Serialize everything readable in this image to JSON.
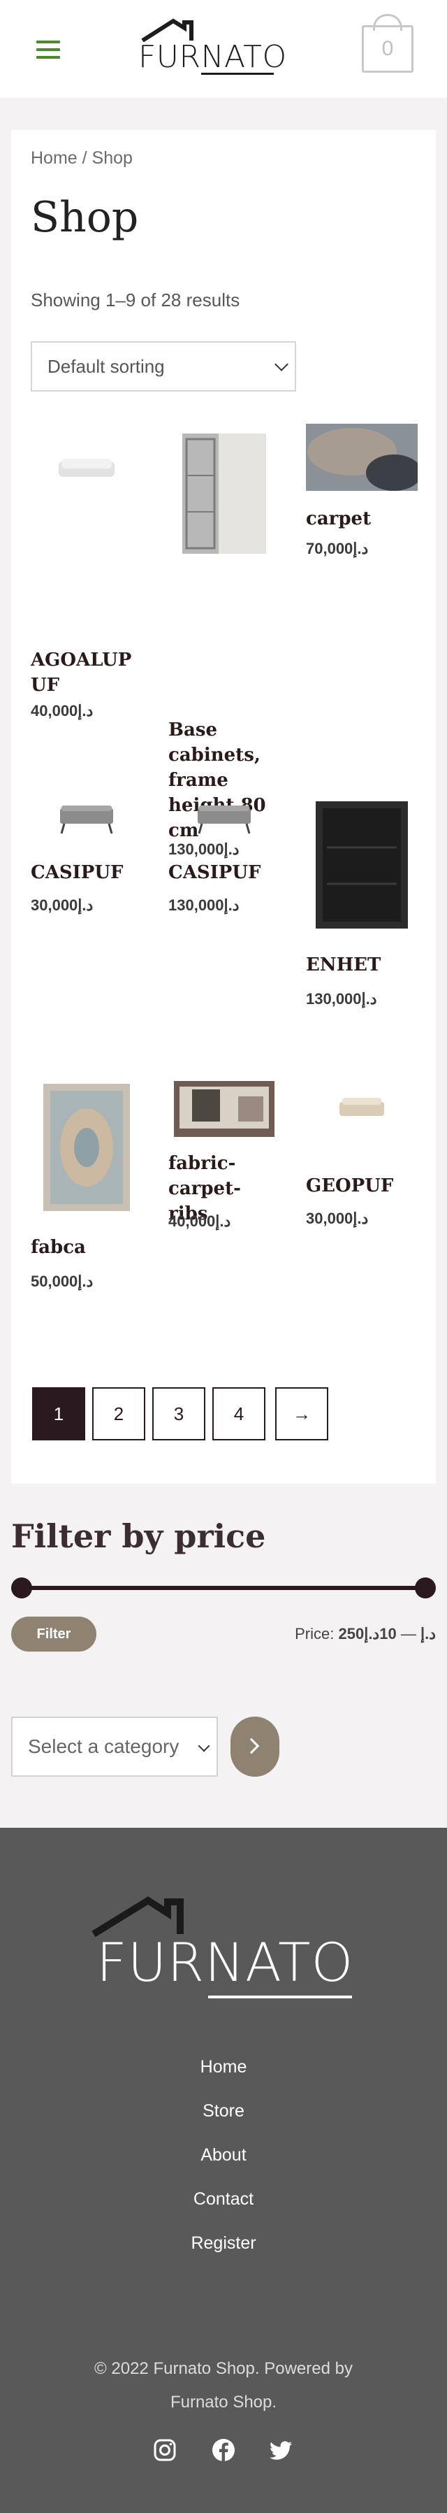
{
  "header": {
    "logo_text": "FURNATO",
    "cart_count": "0"
  },
  "breadcrumb": "Home / Shop",
  "page_title": "Shop",
  "result_count": "Showing 1–9 of 28 results",
  "sorting": {
    "selected": "Default sorting"
  },
  "products": [
    {
      "name": "AGOALUP UF",
      "price": "40,000د.إ"
    },
    {
      "name": "Base cabinets, frame height 80 cm",
      "price": "130,000د.إ"
    },
    {
      "name": "carpet",
      "price": "70,000د.إ"
    },
    {
      "name": "CASIPUF",
      "price": "30,000د.إ"
    },
    {
      "name": "CASIPUF",
      "price": "130,000د.إ"
    },
    {
      "name": "ENHET",
      "price": "130,000د.إ"
    },
    {
      "name": "fabca",
      "price": "50,000د.إ"
    },
    {
      "name": "fabric-carpet-ribs",
      "price": "40,000د.إ"
    },
    {
      "name": "GEOPUF",
      "price": "30,000د.إ"
    }
  ],
  "pagination": {
    "pages": [
      "1",
      "2",
      "3",
      "4"
    ],
    "current": "1",
    "next": "→"
  },
  "price_filter": {
    "title": "Filter by price",
    "button": "Filter",
    "label_prefix": "Price:",
    "min": "250د.إ",
    "separator": "—",
    "max": "10د.إ"
  },
  "category_filter": {
    "placeholder": "Select a category"
  },
  "footer": {
    "logo_text": "FURNATO",
    "links": [
      "Home",
      "Store",
      "About",
      "Contact",
      "Register"
    ],
    "copyright_line1": "© 2022 Furnato Shop. Powered by",
    "copyright_line2": "Furnato Shop.",
    "social": [
      "instagram-icon",
      "facebook-icon",
      "twitter-icon"
    ]
  },
  "colors": {
    "accent_dark": "#2a1a1f",
    "button_taupe": "#8e8371",
    "hamburger_green": "#4a8c2a",
    "footer_bg": "#595959"
  }
}
